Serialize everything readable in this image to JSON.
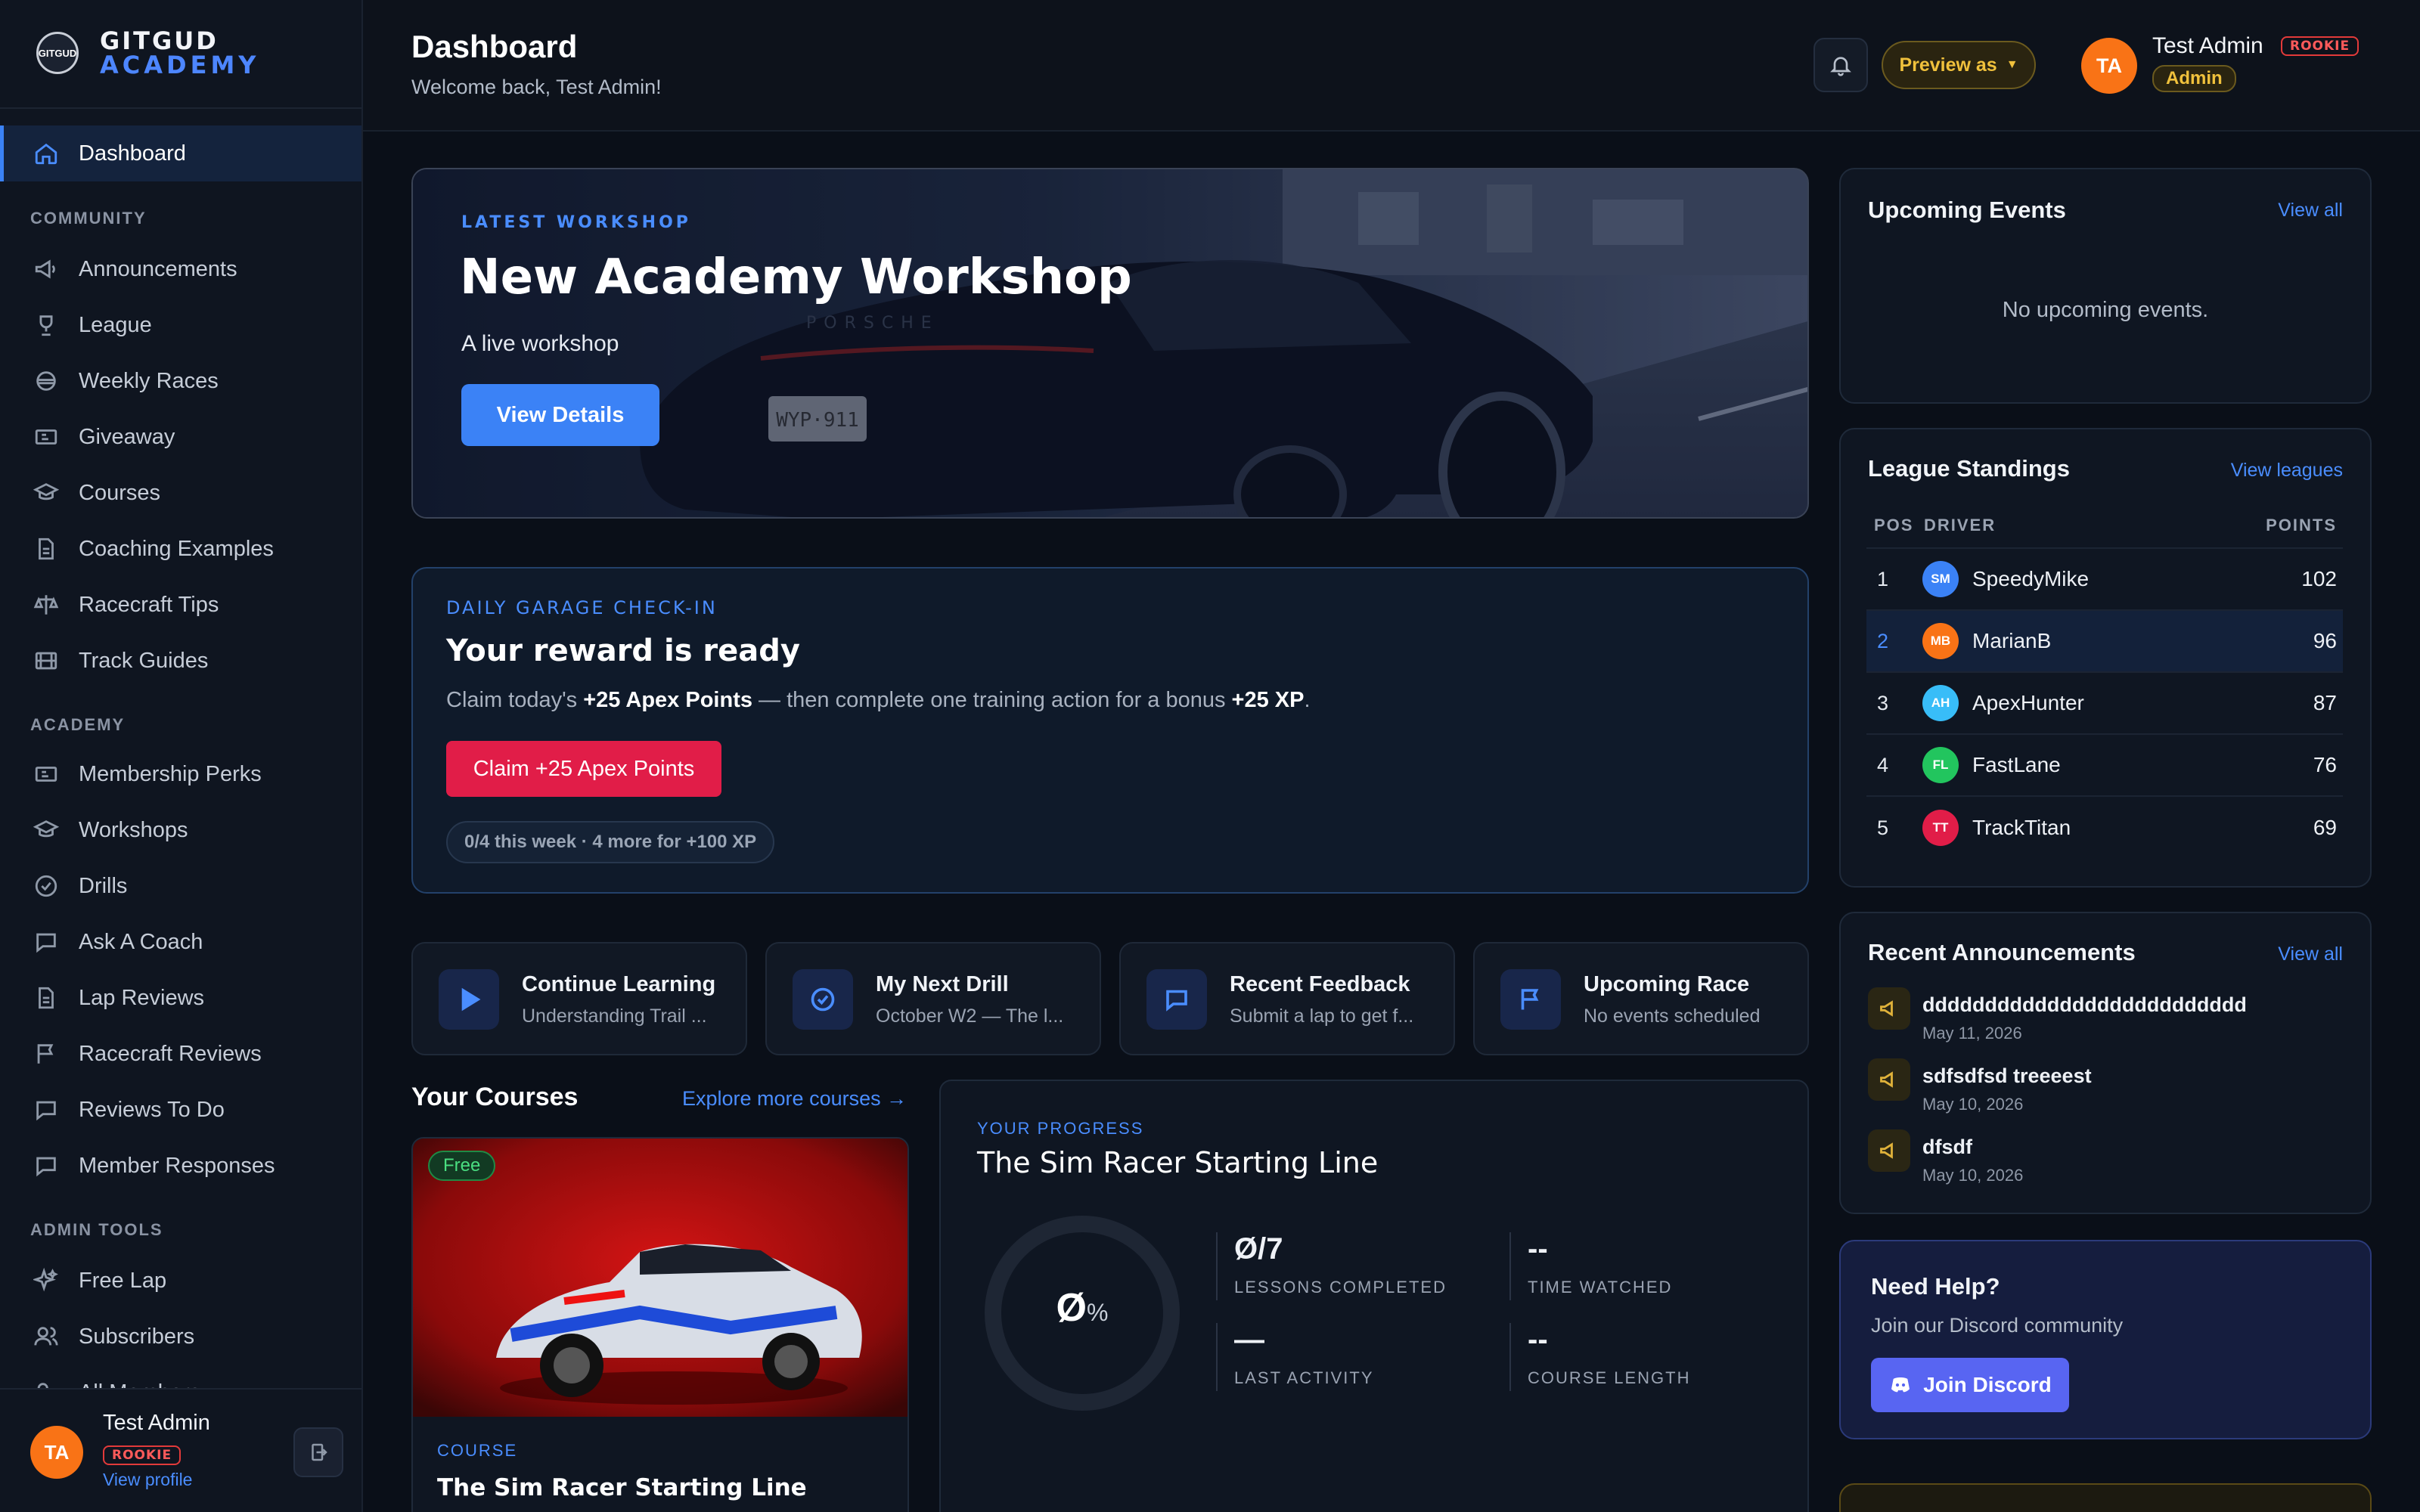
{
  "brand": {
    "line1": "GITGUD",
    "line2": "ACADEMY",
    "badge_text": "GITGUD"
  },
  "sidebar": {
    "active": {
      "label": "Dashboard",
      "icon": "home-icon"
    },
    "sections": [
      {
        "label": "COMMUNITY",
        "items": [
          {
            "label": "Announcements",
            "icon": "megaphone-icon"
          },
          {
            "label": "League",
            "icon": "trophy-icon"
          },
          {
            "label": "Weekly Races",
            "icon": "helmet-icon"
          },
          {
            "label": "Giveaway",
            "icon": "ticket-icon"
          },
          {
            "label": "Courses",
            "icon": "graduation-cap-icon"
          },
          {
            "label": "Coaching Examples",
            "icon": "document-icon"
          },
          {
            "label": "Racecraft Tips",
            "icon": "scale-icon"
          },
          {
            "label": "Track Guides",
            "icon": "film-icon"
          }
        ]
      },
      {
        "label": "ACADEMY",
        "items": [
          {
            "label": "Membership Perks",
            "icon": "ticket-icon"
          },
          {
            "label": "Workshops",
            "icon": "graduation-cap-icon"
          },
          {
            "label": "Drills",
            "icon": "check-circle-icon"
          },
          {
            "label": "Ask A Coach",
            "icon": "chat-icon"
          },
          {
            "label": "Lap Reviews",
            "icon": "document-icon"
          },
          {
            "label": "Racecraft Reviews",
            "icon": "flag-icon"
          },
          {
            "label": "Reviews To Do",
            "icon": "chat-icon"
          },
          {
            "label": "Member Responses",
            "icon": "chat-icon"
          }
        ]
      },
      {
        "label": "ADMIN TOOLS",
        "items": [
          {
            "label": "Free Lap",
            "icon": "sparkles-icon"
          },
          {
            "label": "Subscribers",
            "icon": "users-icon"
          },
          {
            "label": "All Members",
            "icon": "users-icon"
          }
        ]
      }
    ],
    "footer": {
      "initials": "TA",
      "name": "Test Admin",
      "badge": "ROOKIE",
      "link": "View profile"
    }
  },
  "header": {
    "title": "Dashboard",
    "subtitle": "Welcome back, Test Admin!",
    "preview_label": "Preview as",
    "user": {
      "initials": "TA",
      "name": "Test Admin",
      "badge": "ROOKIE",
      "role": "Admin"
    }
  },
  "hero": {
    "eyebrow": "LATEST WORKSHOP",
    "title": "New Academy Workshop",
    "subtitle": "A live workshop",
    "button": "View Details",
    "plate": "WYP·911",
    "car_text": "PORSCHE"
  },
  "checkin": {
    "eyebrow": "DAILY GARAGE CHECK-IN",
    "title": "Your reward is ready",
    "desc_pre": "Claim today's ",
    "desc_b1": "+25 Apex Points",
    "desc_mid": " — then complete one training action for a bonus ",
    "desc_b2": "+25 XP",
    "desc_end": ".",
    "button": "Claim +25 Apex Points",
    "progress": "0/4 this week · 4 more for +100 XP"
  },
  "quick": [
    {
      "title": "Continue Learning",
      "sub": "Understanding Trail ...",
      "icon": "play-icon"
    },
    {
      "title": "My Next Drill",
      "sub": "October W2 — The l...",
      "icon": "check-circle-icon"
    },
    {
      "title": "Recent Feedback",
      "sub": "Submit a lap to get f...",
      "icon": "chat-icon"
    },
    {
      "title": "Upcoming Race",
      "sub": "No events scheduled",
      "icon": "flag-icon"
    }
  ],
  "courses": {
    "title": "Your Courses",
    "explore": "Explore more courses →",
    "card": {
      "badge": "Free",
      "label": "COURSE",
      "title": "The Sim Racer Starting Line"
    }
  },
  "progress": {
    "eyebrow": "YOUR PROGRESS",
    "title": "The Sim Racer Starting Line",
    "percent_value": "Ø",
    "percent_sign": "%",
    "ring_fraction": 0,
    "stats": [
      {
        "value": "Ø/7",
        "label": "LESSONS COMPLETED"
      },
      {
        "value": "--",
        "label": "TIME WATCHED"
      },
      {
        "value": "—",
        "label": "LAST ACTIVITY"
      },
      {
        "value": "--",
        "label": "COURSE LENGTH"
      }
    ]
  },
  "events": {
    "title": "Upcoming Events",
    "link": "View all",
    "empty": "No upcoming events."
  },
  "standings": {
    "title": "League Standings",
    "link": "View leagues",
    "headers": {
      "pos": "POS",
      "driver": "DRIVER",
      "points": "POINTS"
    },
    "rows": [
      {
        "pos": "1",
        "initials": "SM",
        "name": "SpeedyMike",
        "points": "102",
        "color": "#3b82f6"
      },
      {
        "pos": "2",
        "initials": "MB",
        "name": "MarianB",
        "points": "96",
        "color": "#f97316"
      },
      {
        "pos": "3",
        "initials": "AH",
        "name": "ApexHunter",
        "points": "87",
        "color": "#38bdf8"
      },
      {
        "pos": "4",
        "initials": "FL",
        "name": "FastLane",
        "points": "76",
        "color": "#22c55e"
      },
      {
        "pos": "5",
        "initials": "TT",
        "name": "TrackTitan",
        "points": "69",
        "color": "#e11d48"
      }
    ]
  },
  "announcements": {
    "title": "Recent Announcements",
    "link": "View all",
    "items": [
      {
        "title": "dddddddddddddddddddddddddd",
        "date": "May 11, 2026"
      },
      {
        "title": "sdfsdfsd treeeest",
        "date": "May 10, 2026"
      },
      {
        "title": "dfsdf",
        "date": "May 10, 2026"
      }
    ]
  },
  "help": {
    "title": "Need Help?",
    "sub": "Join our Discord community",
    "button": "Join Discord"
  },
  "colors": {
    "accent": "#3b82f6",
    "danger": "#e11d48",
    "gold": "#e0b23a",
    "discord": "#5865f2"
  }
}
